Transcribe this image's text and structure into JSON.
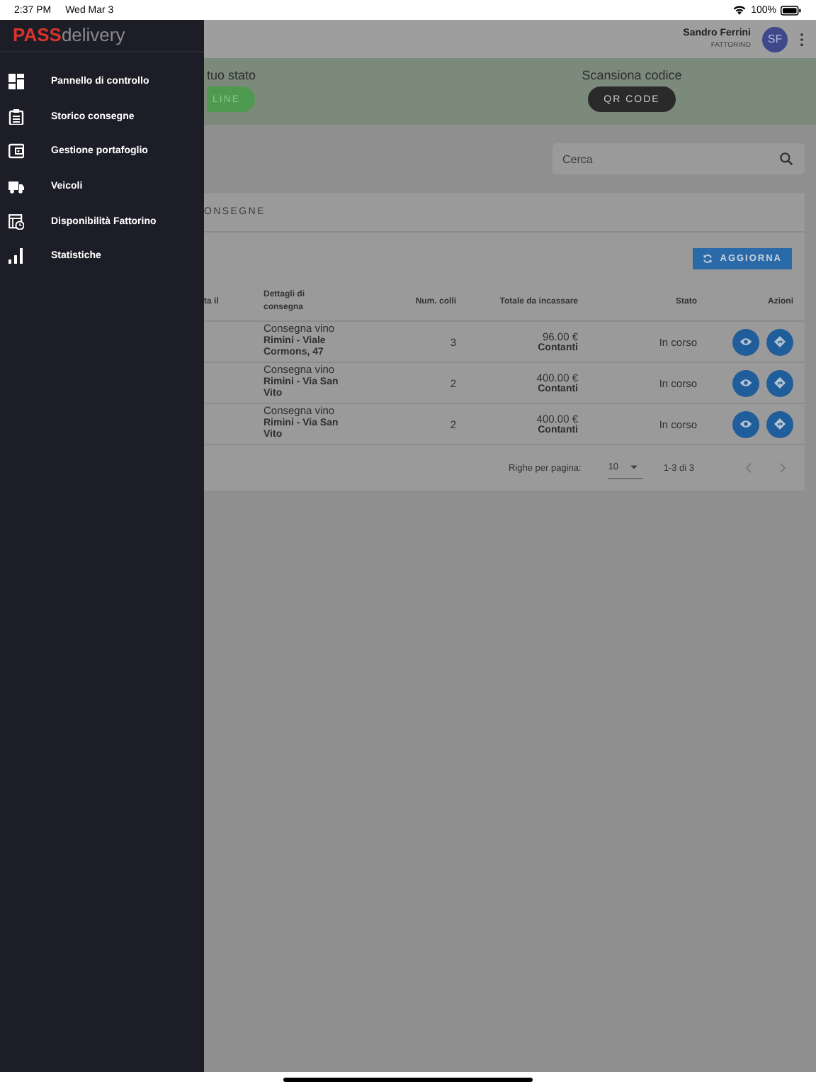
{
  "status_bar": {
    "time": "2:37 PM",
    "date": "Wed Mar 3",
    "battery": "100%"
  },
  "drawer": {
    "logo": {
      "strong": "PASS",
      "light": "delivery"
    },
    "items": [
      {
        "label": "Pannello di controllo"
      },
      {
        "label": "Storico consegne"
      },
      {
        "label": "Gestione portafoglio"
      },
      {
        "label": "Veicoli"
      },
      {
        "label": "Disponibilità Fattorino"
      },
      {
        "label": "Statistiche"
      }
    ]
  },
  "header": {
    "user_name": "Sandro Ferrini",
    "user_role": "FATTORINO",
    "avatar_initials": "SF"
  },
  "status_panel": {
    "label": "tuo stato",
    "button": "LINE"
  },
  "scan_panel": {
    "label": "Scansiona codice",
    "button": "QR CODE"
  },
  "search": {
    "placeholder": "Cerca"
  },
  "card": {
    "title": "ONSEGNE",
    "refresh_button": "AGGIORNA"
  },
  "table": {
    "columns": [
      "ta il",
      "Dettagli di consegna",
      "Num. colli",
      "Totale da incassare",
      "Stato",
      "Azioni"
    ],
    "rows": [
      {
        "title": "Consegna vino",
        "address": "Rimini - Viale Cormons, 47",
        "packages": "3",
        "amount": "96.00 €",
        "payment": "Contanti",
        "status": "In corso"
      },
      {
        "title": "Consegna vino",
        "address": "Rimini - Via San Vito",
        "packages": "2",
        "amount": "400.00 €",
        "payment": "Contanti",
        "status": "In corso"
      },
      {
        "title": "Consegna vino",
        "address": "Rimini - Via San Vito",
        "packages": "2",
        "amount": "400.00 €",
        "payment": "Contanti",
        "status": "In corso"
      }
    ]
  },
  "pagination": {
    "rows_per_page_label": "Righe per pagina:",
    "rows_per_page": "10",
    "range": "1-3 di 3"
  }
}
